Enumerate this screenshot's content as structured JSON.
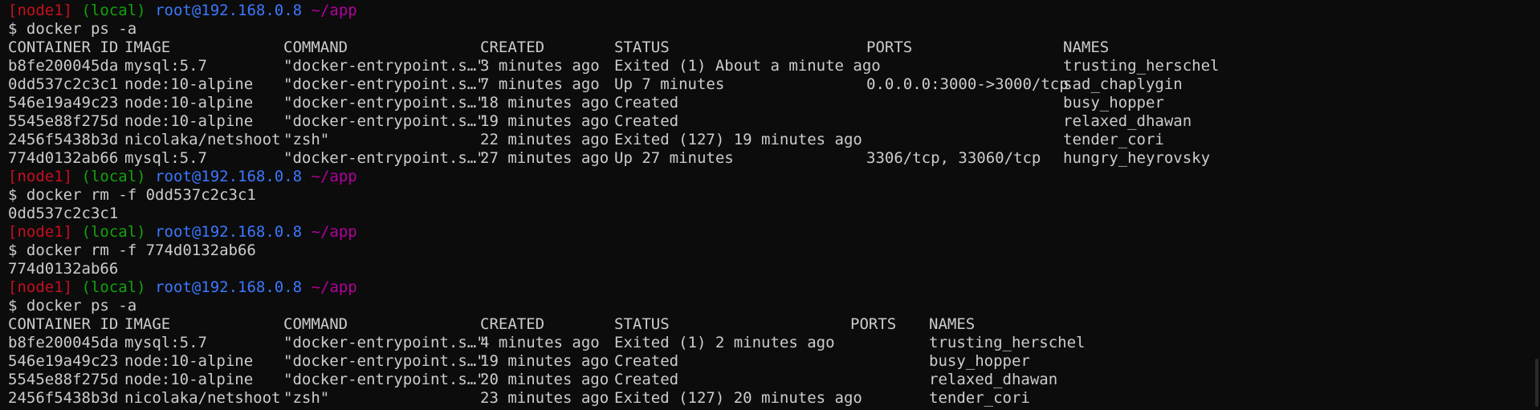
{
  "prompt": {
    "node": "[node1]",
    "scope": "(local)",
    "host": "root@192.168.0.8",
    "path": "~/app"
  },
  "colors": {
    "background": "#0c0c0c",
    "text": "#cccccc",
    "prompt_node": "#c50f1f",
    "prompt_scope": "#13a10e",
    "prompt_host": "#3b78ff",
    "prompt_path": "#b4009e"
  },
  "blocks": [
    {
      "command": "$ docker ps -a",
      "table": {
        "headers": [
          "CONTAINER ID",
          "IMAGE",
          "COMMAND",
          "CREATED",
          "STATUS",
          "PORTS",
          "NAMES"
        ],
        "rows": [
          [
            "b8fe200045da",
            "mysql:5.7",
            "\"docker-entrypoint.s…\"",
            "3 minutes ago",
            "Exited (1) About a minute ago",
            "",
            "trusting_herschel"
          ],
          [
            "0dd537c2c3c1",
            "node:10-alpine",
            "\"docker-entrypoint.s…\"",
            "7 minutes ago",
            "Up 7 minutes",
            "0.0.0.0:3000->3000/tcp",
            "sad_chaplygin"
          ],
          [
            "546e19a49c23",
            "node:10-alpine",
            "\"docker-entrypoint.s…\"",
            "18 minutes ago",
            "Created",
            "",
            "busy_hopper"
          ],
          [
            "5545e88f275d",
            "node:10-alpine",
            "\"docker-entrypoint.s…\"",
            "19 minutes ago",
            "Created",
            "",
            "relaxed_dhawan"
          ],
          [
            "2456f5438b3d",
            "nicolaka/netshoot",
            "\"zsh\"",
            "22 minutes ago",
            "Exited (127) 19 minutes ago",
            "",
            "tender_cori"
          ],
          [
            "774d0132ab66",
            "mysql:5.7",
            "\"docker-entrypoint.s…\"",
            "27 minutes ago",
            "Up 27 minutes",
            "3306/tcp, 33060/tcp",
            "hungry_heyrovsky"
          ]
        ]
      }
    },
    {
      "command": "$ docker rm -f 0dd537c2c3c1",
      "output": "0dd537c2c3c1"
    },
    {
      "command": "$ docker rm -f 774d0132ab66",
      "output": "774d0132ab66"
    },
    {
      "command": "$ docker ps -a",
      "table": {
        "headers": [
          "CONTAINER ID",
          "IMAGE",
          "COMMAND",
          "CREATED",
          "STATUS",
          "PORTS",
          "NAMES"
        ],
        "rows": [
          [
            "b8fe200045da",
            "mysql:5.7",
            "\"docker-entrypoint.s…\"",
            "4 minutes ago",
            "Exited (1) 2 minutes ago",
            "",
            "trusting_herschel"
          ],
          [
            "546e19a49c23",
            "node:10-alpine",
            "\"docker-entrypoint.s…\"",
            "19 minutes ago",
            "Created",
            "",
            "busy_hopper"
          ],
          [
            "5545e88f275d",
            "node:10-alpine",
            "\"docker-entrypoint.s…\"",
            "20 minutes ago",
            "Created",
            "",
            "relaxed_dhawan"
          ],
          [
            "2456f5438b3d",
            "nicolaka/netshoot",
            "\"zsh\"",
            "23 minutes ago",
            "Exited (127) 20 minutes ago",
            "",
            "tender_cori"
          ]
        ]
      }
    }
  ]
}
